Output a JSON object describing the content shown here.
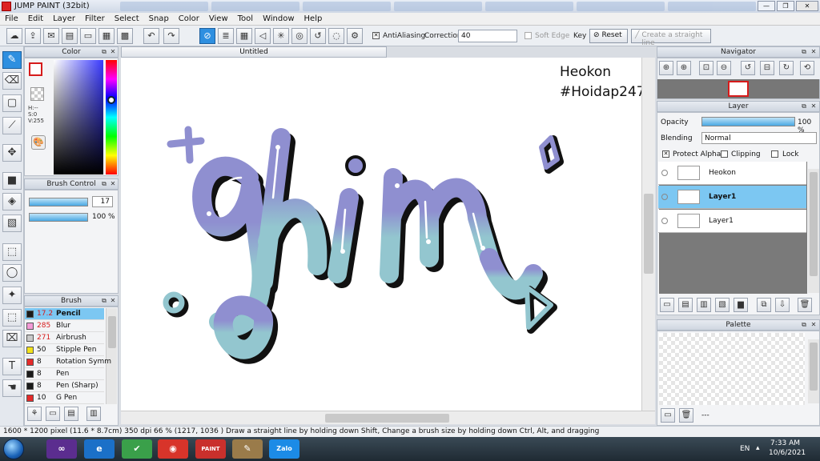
{
  "window": {
    "title": "JUMP PAINT (32bit)",
    "min": "—",
    "max": "❐",
    "close": "✕"
  },
  "menu": [
    "File",
    "Edit",
    "Layer",
    "Filter",
    "Select",
    "Snap",
    "Color",
    "View",
    "Tool",
    "Window",
    "Help"
  ],
  "toolbar": {
    "antialiasing_label": "AntiAliasing",
    "correction_label": "Correction",
    "correction_value": "40",
    "soft_edge_label": "Soft Edge",
    "key_label": "Key",
    "reset_label": "Reset",
    "straight_line_label": "Create a straight line"
  },
  "color_panel": {
    "title": "Color",
    "readout_h": "H:--",
    "readout_s": "S:0",
    "readout_v": "V:255",
    "fg": "#d61b1b"
  },
  "brush_control": {
    "title": "Brush Control",
    "size": "17",
    "opacity": "100 %"
  },
  "brush_panel": {
    "title": "Brush",
    "items": [
      {
        "size": "17.2",
        "name": "Pencil",
        "color": "#1b1b1b"
      },
      {
        "size": "285",
        "name": "Blur",
        "color": "#f39ad6"
      },
      {
        "size": "271",
        "name": "Airbrush",
        "color": "#c9c9c9"
      },
      {
        "size": "50",
        "name": "Stipple Pen",
        "color": "#f2e21a"
      },
      {
        "size": "8",
        "name": "Rotation Symm",
        "color": "#e42a2a"
      },
      {
        "size": "8",
        "name": "Pen",
        "color": "#1b1b1b"
      },
      {
        "size": "8",
        "name": "Pen (Sharp)",
        "color": "#1b1b1b"
      },
      {
        "size": "10",
        "name": "G Pen",
        "color": "#e42a2a"
      }
    ]
  },
  "canvas": {
    "tab": "Untitled",
    "text_line1": "Heokon",
    "text_line2": "#Hoidap247",
    "gradient_top": "#8f8fd0",
    "gradient_bottom": "#93c6cf"
  },
  "navigator": {
    "title": "Navigator"
  },
  "layer_panel": {
    "title": "Layer",
    "opacity_label": "Opacity",
    "opacity_value": "100 %",
    "blending_label": "Blending",
    "blending_value": "Normal",
    "protect_alpha": "Protect Alpha",
    "clipping": "Clipping",
    "lock": "Lock",
    "layers": [
      {
        "name": "Heokon",
        "selected": false
      },
      {
        "name": "Layer1",
        "selected": true
      },
      {
        "name": "Layer1",
        "selected": false
      }
    ]
  },
  "palette": {
    "title": "Palette",
    "footer_text": "---"
  },
  "status": "1600 * 1200 pixel   (11.6 * 8.7cm)   350 dpi   66 %   (1217, 1036 )   Draw a straight line by holding down Shift, Change a brush size by holding down Ctrl, Alt, and dragging",
  "taskbar": {
    "lang": "EN",
    "time": "7:33 AM",
    "date": "10/6/2021",
    "zalo": "Zalo"
  }
}
